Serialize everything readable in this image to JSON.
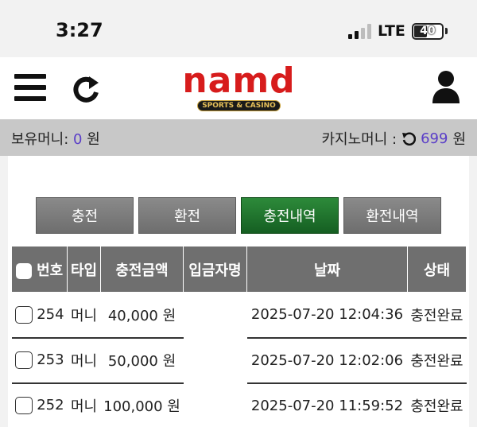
{
  "status_bar": {
    "time": "3:27",
    "network": "LTE",
    "battery": "40"
  },
  "header": {
    "logo_text": "namd",
    "logo_sub": "SPORTS & CASINO",
    "icons": [
      "menu-icon",
      "refresh-icon",
      "user-icon"
    ]
  },
  "money": {
    "held_label": "보유머니:",
    "held_value": "0",
    "held_unit": "원",
    "casino_label": "카지노머니 :",
    "casino_value": "699",
    "casino_unit": "원"
  },
  "tabs": [
    {
      "label": "충전",
      "active": false
    },
    {
      "label": "환전",
      "active": false
    },
    {
      "label": "충전내역",
      "active": true
    },
    {
      "label": "환전내역",
      "active": false
    }
  ],
  "table": {
    "headers": [
      "번호",
      "타입",
      "충전금액",
      "입금자명",
      "날짜",
      "상태"
    ],
    "rows": [
      {
        "no": "254",
        "type": "머니",
        "amount": "40,000 원",
        "depositor": "",
        "date": "2025-07-20 12:04:36",
        "status": "충전완료"
      },
      {
        "no": "253",
        "type": "머니",
        "amount": "50,000 원",
        "depositor": "",
        "date": "2025-07-20 12:02:06",
        "status": "충전완료"
      },
      {
        "no": "252",
        "type": "머니",
        "amount": "100,000 원",
        "depositor": "",
        "date": "2025-07-20 11:59:52",
        "status": "충전완료"
      }
    ]
  },
  "colors": {
    "accent_green": "#155f22",
    "logo_red": "#d71c1c",
    "money_value": "#5a3ec8"
  }
}
